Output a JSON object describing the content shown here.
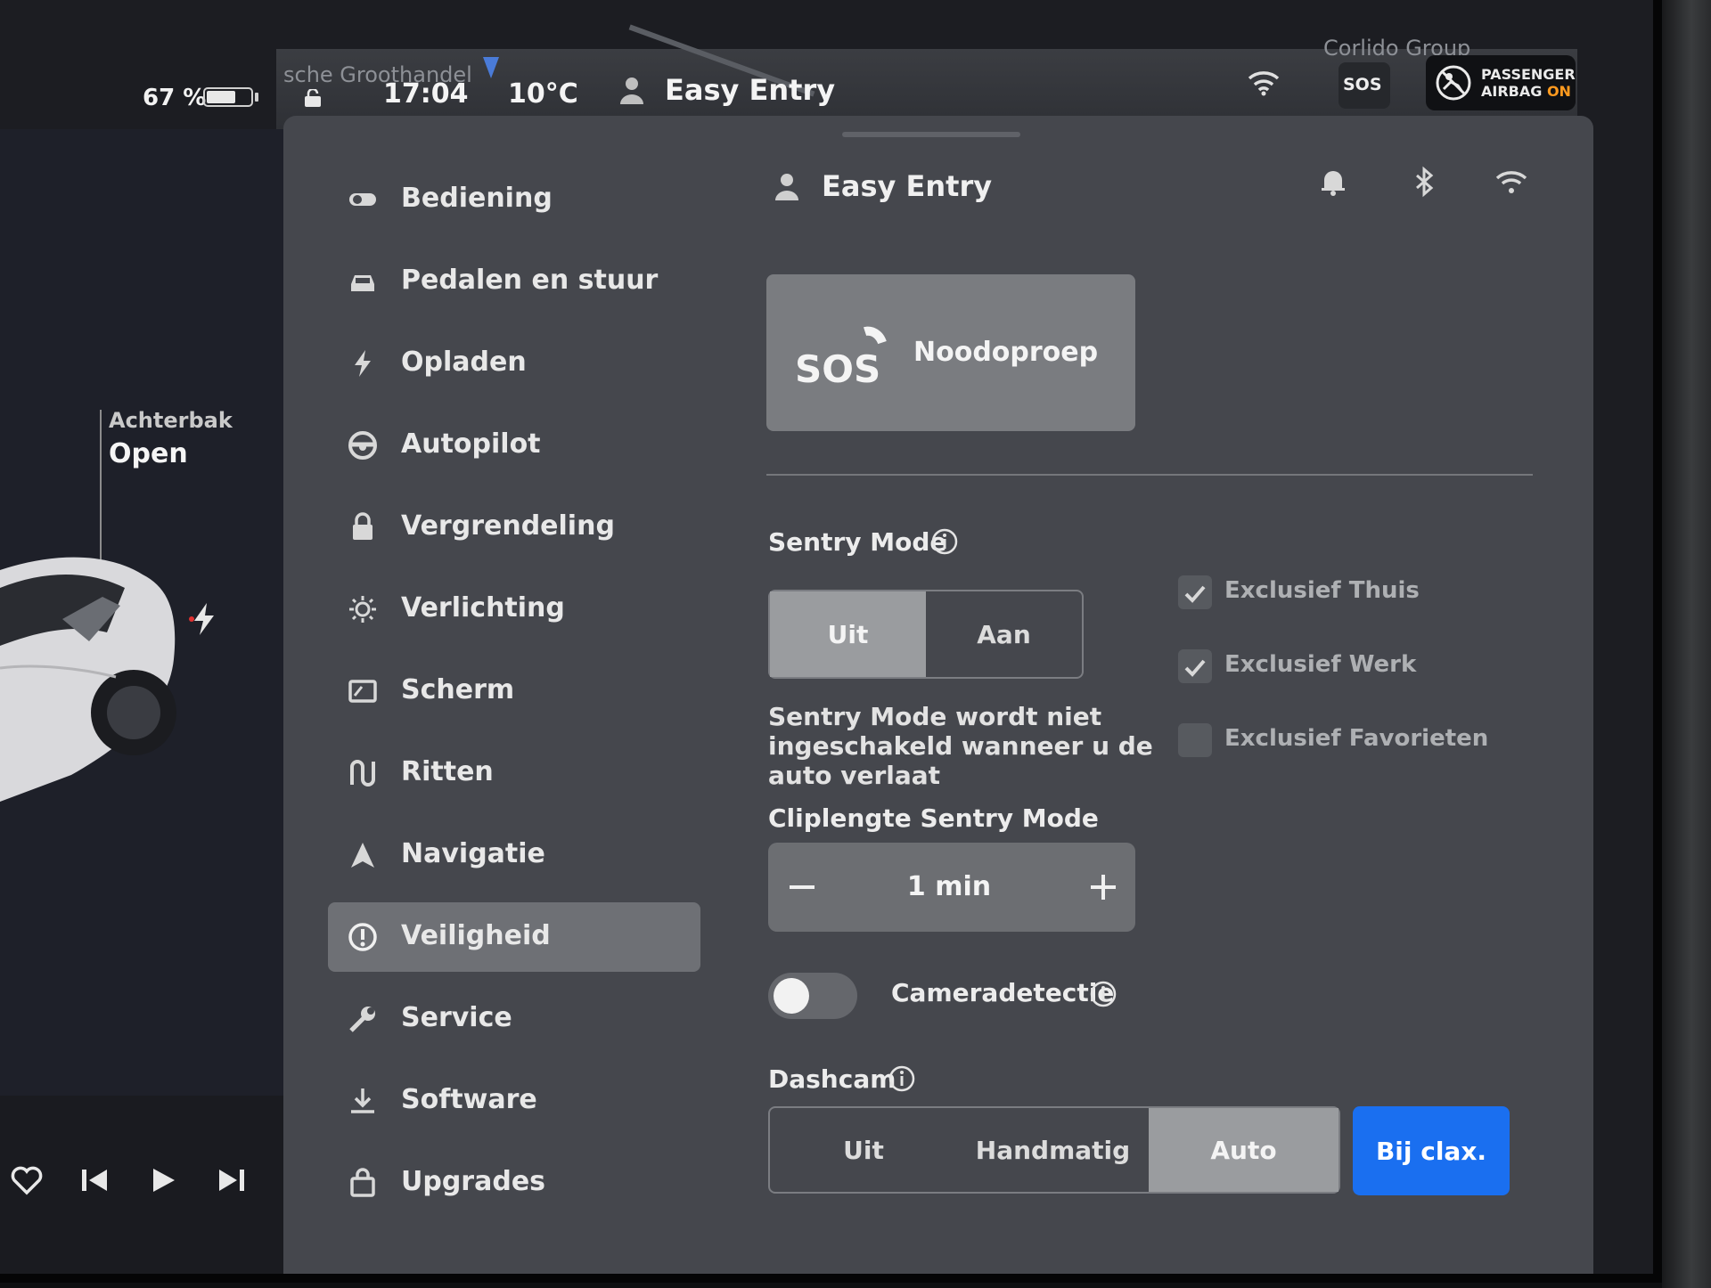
{
  "status_bar": {
    "battery_percent_text": "67 %",
    "battery_level": 0.67,
    "time": "17:04",
    "temperature": "10°C",
    "profile_name": "Easy Entry",
    "sos_label": "SOS",
    "airbag_line1": "PASSENGER",
    "airbag_line2_prefix": "AIRBAG ",
    "airbag_line2_state": "ON",
    "map_label_left": "sche Groothandel",
    "map_label_right": "Corlido Group"
  },
  "car_panel": {
    "trunk_label": "Achterbak",
    "trunk_state": "Open"
  },
  "menu": {
    "items": [
      {
        "label": "Bediening",
        "icon": "toggle-icon"
      },
      {
        "label": "Pedalen en stuur",
        "icon": "car-icon"
      },
      {
        "label": "Opladen",
        "icon": "bolt-icon"
      },
      {
        "label": "Autopilot",
        "icon": "steering-wheel-icon"
      },
      {
        "label": "Vergrendeling",
        "icon": "lock-icon"
      },
      {
        "label": "Verlichting",
        "icon": "sun-icon"
      },
      {
        "label": "Scherm",
        "icon": "display-icon"
      },
      {
        "label": "Ritten",
        "icon": "trips-icon"
      },
      {
        "label": "Navigatie",
        "icon": "navigation-icon"
      },
      {
        "label": "Veiligheid",
        "icon": "shield-alert-icon"
      },
      {
        "label": "Service",
        "icon": "wrench-icon"
      },
      {
        "label": "Software",
        "icon": "download-icon"
      },
      {
        "label": "Upgrades",
        "icon": "bag-icon"
      }
    ],
    "active_index": 9
  },
  "content": {
    "profile_name": "Easy Entry",
    "sos_card": {
      "sos": "SOS",
      "label": "Noodoproep"
    },
    "sentry": {
      "title": "Sentry Mode",
      "off_label": "Uit",
      "on_label": "Aan",
      "selected": "Uit",
      "description": "Sentry Mode wordt niet ingeschakeld wanneer u de auto verlaat",
      "options": [
        {
          "label": "Exclusief Thuis",
          "checked": true
        },
        {
          "label": "Exclusief Werk",
          "checked": true
        },
        {
          "label": "Exclusief Favorieten",
          "checked": false
        }
      ]
    },
    "clip_length": {
      "title": "Cliplengte Sentry Mode",
      "value": "1 min"
    },
    "camera_detection": {
      "label": "Cameradetectie",
      "enabled": false
    },
    "dashcam": {
      "title": "Dashcam",
      "options": [
        "Uit",
        "Handmatig",
        "Auto",
        "Bij clax."
      ],
      "selected": "Auto",
      "accent_option": "Bij clax.",
      "accent_color": "#1a6ff0"
    }
  }
}
